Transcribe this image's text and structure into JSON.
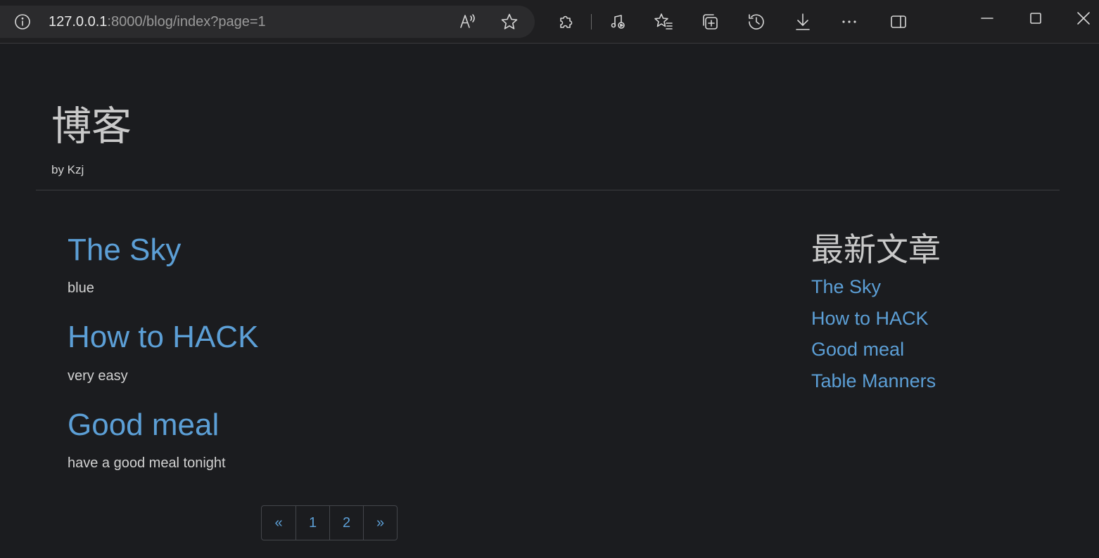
{
  "browser": {
    "url_host": "127.0.0.1",
    "url_rest": ":8000/blog/index?page=1",
    "icons": {
      "info": "info-icon",
      "read_aloud": "read-aloud-icon",
      "favorite": "star-icon",
      "extensions": "puzzle-icon",
      "media": "media-control-icon",
      "favorites": "favorites-list-icon",
      "collections": "collections-icon",
      "history": "history-icon",
      "downloads": "download-icon",
      "more": "more-icon",
      "sidebar": "sidebar-icon",
      "minimize": "minimize-icon",
      "maximize": "maximize-icon",
      "close": "close-icon"
    }
  },
  "header": {
    "title": "博客",
    "byline": "by Kzj"
  },
  "posts": [
    {
      "title": "The Sky",
      "summary": "blue"
    },
    {
      "title": "How to HACK",
      "summary": "very easy"
    },
    {
      "title": "Good meal",
      "summary": "have a good meal tonight"
    }
  ],
  "pagination": {
    "prev": "«",
    "pages": [
      "1",
      "2"
    ],
    "next": "»"
  },
  "sidebar": {
    "title": "最新文章",
    "items": [
      "The Sky",
      "How to HACK",
      "Good meal",
      "Table Manners"
    ]
  },
  "colors": {
    "background": "#1b1c1f",
    "link": "#5c9fd6",
    "heading": "#c9c9c9",
    "text": "#d2d2d2"
  }
}
